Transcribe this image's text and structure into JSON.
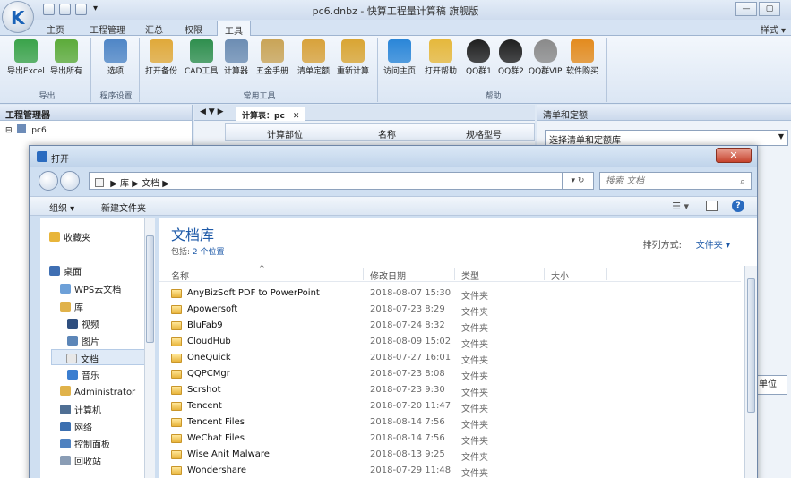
{
  "app": {
    "title": "pc6.dnbz - 快算工程量计算稿 旗舰版",
    "style_menu": "样式 ▾",
    "window_controls": [
      "—",
      "▢"
    ],
    "quick_access": [
      "folder-icon",
      "save-icon",
      "print-icon",
      "dropdown-icon"
    ],
    "qa_more": "▾"
  },
  "ribbon": {
    "tabs": [
      "主页",
      "工程管理",
      "汇总",
      "权限",
      "工具"
    ],
    "active_tab": "工具",
    "groups": [
      {
        "label": "导出",
        "buttons": [
          {
            "label": "导出Excel",
            "color": "#3aa34a"
          },
          {
            "label": "导出所有",
            "color": "#5cab3a"
          }
        ]
      },
      {
        "label": "程序设置",
        "buttons": [
          {
            "label": "选项",
            "color": "#4f86c6"
          }
        ]
      },
      {
        "label": "常用工具",
        "buttons": [
          {
            "label": "打开备份",
            "color": "#e0a93a"
          },
          {
            "label": "CAD工具",
            "color": "#2f8f4e"
          },
          {
            "label": "计算器",
            "color": "#6c8db3"
          },
          {
            "label": "五金手册",
            "color": "#c9a457"
          },
          {
            "label": "清单定额",
            "color": "#d8a23b"
          },
          {
            "label": "重新计算",
            "color": "#d9a533"
          }
        ]
      },
      {
        "label": "帮助",
        "buttons": [
          {
            "label": "访问主页",
            "color": "#2a86d8"
          },
          {
            "label": "打开帮助",
            "color": "#e6b83c"
          },
          {
            "label": "QQ群1",
            "color": "#1f1f1f"
          },
          {
            "label": "QQ群2",
            "color": "#1f1f1f"
          },
          {
            "label": "QQ群VIP",
            "color": "#8a8a8a"
          },
          {
            "label": "软件购买",
            "color": "#e38b1e"
          }
        ]
      }
    ]
  },
  "tree": {
    "header": "工程管理器",
    "root_expander": "⊟",
    "root": "pc6"
  },
  "calc": {
    "nav_arrows": "◀ ▼ ▶",
    "tab_label": "计算表：pc",
    "tab_close": "✕",
    "columns": [
      "计算部位",
      "名称",
      "规格型号"
    ]
  },
  "right_pane": {
    "header": "清单和定额",
    "select_value": "选择清单和定额库",
    "dropdown_arrow": "▼",
    "unit_label": "单位"
  },
  "dialog": {
    "title": "打开",
    "close": "✕",
    "breadcrumb": "▶ 库 ▶ 文档 ▶",
    "refresh": "▾ ↻",
    "search_placeholder": "搜索 文档",
    "search_icon": "⌕",
    "toolbar": {
      "organize": "组织 ▾",
      "new_folder": "新建文件夹",
      "view": "☰ ▾",
      "help": "?"
    },
    "nav": {
      "items": [
        {
          "label": "收藏夹",
          "icon": "star-icon",
          "color": "#e8b53a"
        },
        {
          "label": "桌面",
          "icon": "desktop-icon",
          "color": "#3f6fb3"
        },
        {
          "label": "WPS云文档",
          "icon": "cloud-icon",
          "color": "#6da0d8"
        },
        {
          "label": "库",
          "icon": "library-icon",
          "color": "#e0b24a"
        },
        {
          "label": "视频",
          "icon": "video-icon",
          "color": "#2f4f7f"
        },
        {
          "label": "图片",
          "icon": "picture-icon",
          "color": "#5c86b8"
        },
        {
          "label": "文档",
          "icon": "document-icon",
          "color": "#e8e8e8"
        },
        {
          "label": "音乐",
          "icon": "music-icon",
          "color": "#3b7ed0"
        },
        {
          "label": "Administrator",
          "icon": "user-folder-icon",
          "color": "#e0b24a"
        },
        {
          "label": "计算机",
          "icon": "computer-icon",
          "color": "#4f6f94"
        },
        {
          "label": "网络",
          "icon": "network-icon",
          "color": "#3b6fb0"
        },
        {
          "label": "控制面板",
          "icon": "control-panel-icon",
          "color": "#4f82c0"
        },
        {
          "label": "回收站",
          "icon": "recycle-bin-icon",
          "color": "#8a9db5"
        }
      ],
      "selected": "文档"
    },
    "library": {
      "title": "文档库",
      "includes_label": "包括:",
      "includes_link": "2 个位置",
      "sort_label": "排列方式:",
      "sort_value": "文件夹 ▾"
    },
    "columns": [
      "名称",
      "修改日期",
      "类型",
      "大小"
    ],
    "files": [
      {
        "name": "AnyBizSoft PDF to PowerPoint",
        "date": "2018-08-07 15:30",
        "type": "文件夹"
      },
      {
        "name": "Apowersoft",
        "date": "2018-07-23 8:29",
        "type": "文件夹"
      },
      {
        "name": "BluFab9",
        "date": "2018-07-24 8:32",
        "type": "文件夹"
      },
      {
        "name": "CloudHub",
        "date": "2018-08-09 15:02",
        "type": "文件夹"
      },
      {
        "name": "OneQuick",
        "date": "2018-07-27 16:01",
        "type": "文件夹"
      },
      {
        "name": "QQPCMgr",
        "date": "2018-07-23 8:08",
        "type": "文件夹"
      },
      {
        "name": "Scrshot",
        "date": "2018-07-23 9:30",
        "type": "文件夹"
      },
      {
        "name": "Tencent",
        "date": "2018-07-20 11:47",
        "type": "文件夹"
      },
      {
        "name": "Tencent Files",
        "date": "2018-08-14 7:56",
        "type": "文件夹"
      },
      {
        "name": "WeChat Files",
        "date": "2018-08-14 7:56",
        "type": "文件夹"
      },
      {
        "name": "Wise Anit Malware",
        "date": "2018-08-13 9:25",
        "type": "文件夹"
      },
      {
        "name": "Wondershare",
        "date": "2018-07-29 11:48",
        "type": "文件夹"
      }
    ]
  }
}
